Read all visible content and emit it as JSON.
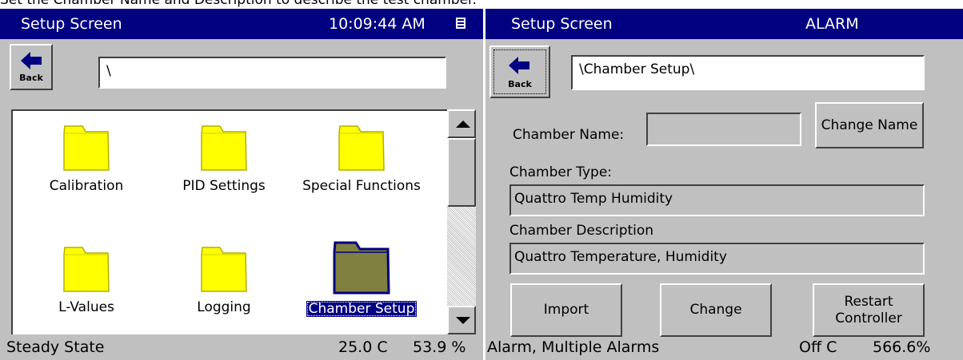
{
  "caption": "Set the Chamber Name and Description to describe the test chamber.",
  "left_panel": {
    "title": "Setup Screen",
    "clock": "10:09:44 AM",
    "back_label": "Back",
    "path": "\\",
    "folders": [
      {
        "label": "Calibration",
        "selected": false
      },
      {
        "label": "PID Settings",
        "selected": false
      },
      {
        "label": "Special Functions",
        "selected": false
      },
      {
        "label": "L-Values",
        "selected": false
      },
      {
        "label": "Logging",
        "selected": false
      },
      {
        "label": "Chamber Setup",
        "selected": true
      }
    ],
    "status": {
      "state": "Steady State",
      "temperature": "25.0 C",
      "humidity": "53.9 %"
    }
  },
  "right_panel": {
    "title": "Setup Screen",
    "alarm": "ALARM",
    "back_label": "Back",
    "path": "\\Chamber Setup\\",
    "chamber_name_label": "Chamber Name:",
    "chamber_name_value": "",
    "change_name_label": "Change Name",
    "chamber_type_label": "Chamber Type:",
    "chamber_type_value": "Quattro Temp Humidity",
    "chamber_desc_label": "Chamber Description",
    "chamber_desc_value": "Quattro Temperature, Humidity",
    "buttons": {
      "import": "Import",
      "change": "Change",
      "restart_line1": "Restart",
      "restart_line2": "Controller"
    },
    "status": {
      "state": "Alarm, Multiple Alarms",
      "temperature": "Off C",
      "humidity": "566.6%"
    }
  },
  "colors": {
    "titlebar": "#000080",
    "panel_bg": "#c0c0c0",
    "folder_yellow": "#ffff00",
    "folder_selected": "#808040"
  }
}
